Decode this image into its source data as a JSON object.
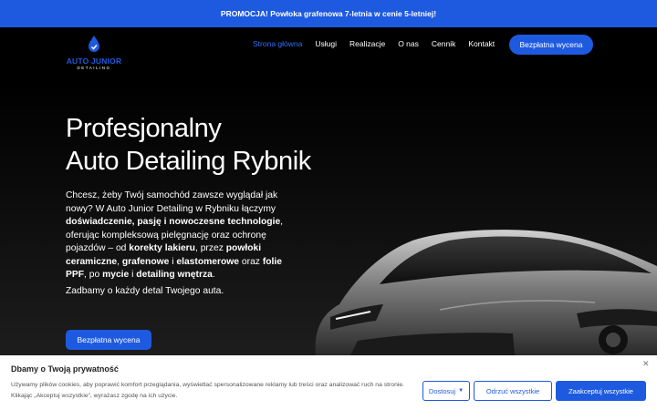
{
  "promo": {
    "text": "PROMOCJA! Powłoka grafenowa 7-letnia w cenie 5-letniej!"
  },
  "logo": {
    "name": "AUTO JUNIOR",
    "sub": "DETAILING",
    "icon": "water-drop-icon"
  },
  "nav": {
    "items": [
      {
        "label": "Strona główna",
        "active": true
      },
      {
        "label": "Usługi",
        "active": false
      },
      {
        "label": "Realizacje",
        "active": false
      },
      {
        "label": "O nas",
        "active": false
      },
      {
        "label": "Cennik",
        "active": false
      },
      {
        "label": "Kontakt",
        "active": false
      }
    ],
    "cta": "Bezpłatna wycena"
  },
  "hero": {
    "title_line1": "Profesjonalny",
    "title_line2": "Auto Detailing Rybnik",
    "desc": [
      {
        "t": "Chcesz, żeby Twój samochód zawsze wyglądał jak nowy? W Auto Junior Detailing w Rybniku łączymy ",
        "b": false
      },
      {
        "t": "doświadczenie, pasję i nowoczesne technologie",
        "b": true
      },
      {
        "t": ", oferując kompleksową pielęgnację oraz ochronę pojazdów – od ",
        "b": false
      },
      {
        "t": "korekty lakieru",
        "b": true
      },
      {
        "t": ", przez ",
        "b": false
      },
      {
        "t": "powłoki ceramiczne",
        "b": true
      },
      {
        "t": ", ",
        "b": false
      },
      {
        "t": "grafenowe",
        "b": true
      },
      {
        "t": " i ",
        "b": false
      },
      {
        "t": "elastomerowe",
        "b": true
      },
      {
        "t": " oraz ",
        "b": false
      },
      {
        "t": "folie PPF",
        "b": true
      },
      {
        "t": ", po ",
        "b": false
      },
      {
        "t": "mycie",
        "b": true
      },
      {
        "t": " i ",
        "b": false
      },
      {
        "t": "detailing wnętrza",
        "b": true
      },
      {
        "t": ".",
        "b": false
      }
    ],
    "tagline": "Zadbamy o każdy detal Twojego auta.",
    "button": "Bezpłatna wycena"
  },
  "cookie": {
    "title": "Dbamy o Twoją prywatność",
    "text": "Używamy plików cookies, aby poprawić komfort przeglądania, wyświetlać spersonalizowane reklamy lub treści oraz analizować ruch na stronie. Klikając „Akceptuj wszystkie”, wyrażasz zgodę na ich użycie.",
    "customize": "Dostosuj",
    "reject": "Odrzuć wszystkie",
    "accept": "Zaakceptuj wszystkie"
  },
  "colors": {
    "accent": "#1e5ae0",
    "active_nav": "#2f6ef5",
    "background": "#000000"
  }
}
